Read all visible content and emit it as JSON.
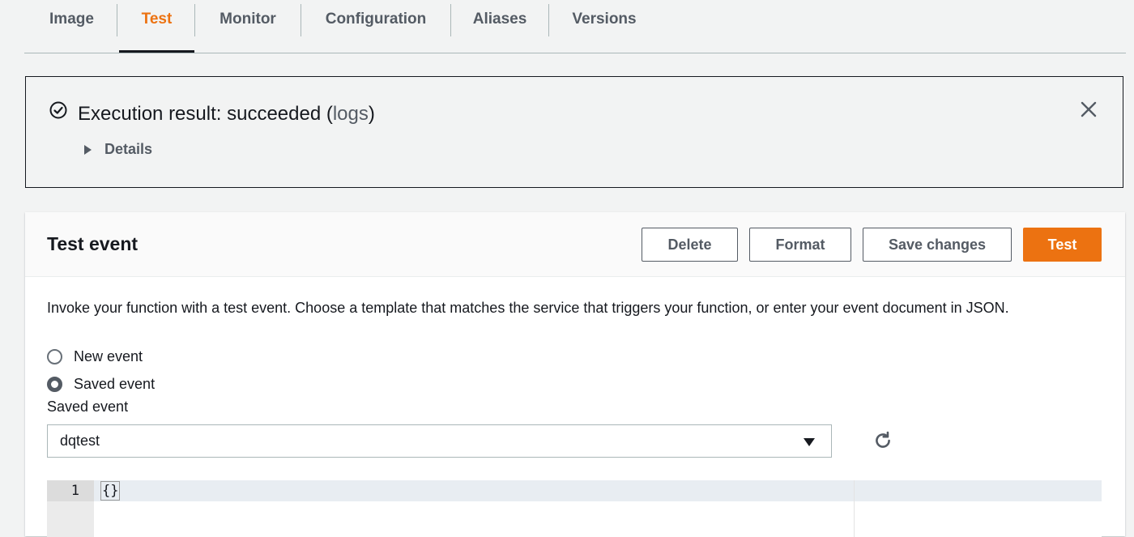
{
  "tabs": [
    {
      "label": "Image",
      "active": false
    },
    {
      "label": "Test",
      "active": true
    },
    {
      "label": "Monitor",
      "active": false
    },
    {
      "label": "Configuration",
      "active": false
    },
    {
      "label": "Aliases",
      "active": false
    },
    {
      "label": "Versions",
      "active": false
    }
  ],
  "alert": {
    "prefix": "Execution result: succeeded (",
    "link": "logs",
    "suffix": ")",
    "details_label": "Details",
    "status_icon": "check-circle-icon",
    "close_icon": "close-icon"
  },
  "panel": {
    "title": "Test event",
    "buttons": {
      "delete": "Delete",
      "format": "Format",
      "save": "Save changes",
      "test": "Test"
    },
    "description": "Invoke your function with a test event. Choose a template that matches the service that triggers your function, or enter your event document in JSON.",
    "radio_new": "New event",
    "radio_saved": "Saved event",
    "selected_radio": "Saved event",
    "saved_event_label": "Saved event",
    "saved_event_value": "dqtest",
    "refresh_icon": "refresh-icon"
  },
  "editor": {
    "line_number": "1",
    "line_text": "{}"
  },
  "colors": {
    "accent": "#ec7211",
    "text": "#16191f",
    "muted": "#545b64"
  }
}
